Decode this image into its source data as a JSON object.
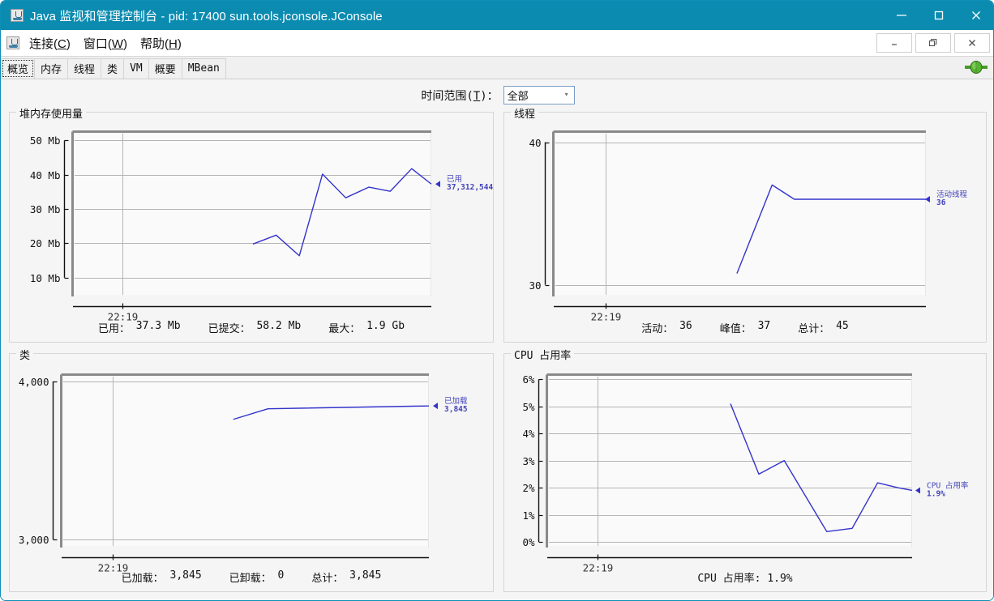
{
  "window": {
    "title": "Java 监视和管理控制台 - pid: 17400 sun.tools.jconsole.JConsole",
    "app_icon": "java-coffee-cup-icon",
    "minimize": "—",
    "maximize": "☐",
    "close": "✕"
  },
  "menubar": {
    "items": [
      {
        "label": "连接(C)",
        "text": "连接(",
        "mnemonic": "C",
        "tail": ")"
      },
      {
        "label": "窗口(W)",
        "text": "窗口(",
        "mnemonic": "W",
        "tail": ")"
      },
      {
        "label": "帮助(H)",
        "text": "帮助(",
        "mnemonic": "H",
        "tail": ")"
      }
    ],
    "inner_minimize": "_",
    "inner_restore": "❐",
    "inner_close": "×"
  },
  "tabs": [
    {
      "label": "概览",
      "selected": true
    },
    {
      "label": "内存",
      "selected": false
    },
    {
      "label": "线程",
      "selected": false
    },
    {
      "label": "类",
      "selected": false
    },
    {
      "label": "VM",
      "selected": false
    },
    {
      "label": "概要",
      "selected": false
    },
    {
      "label": "MBean",
      "selected": false
    }
  ],
  "connection_indicator": "green-plug-connected-icon",
  "timerange": {
    "label_text": "时间范围(",
    "label_mnemonic": "T",
    "label_tail": ")：",
    "value": "全部",
    "chevron": "∨"
  },
  "colors": {
    "titlebar": "#0b8bb0",
    "line": "#3333cc",
    "legend_text": "#4444bb",
    "grid": "#b4b4b4",
    "plot_bg": "#fafafa",
    "panel_border": "#d6d6d6",
    "connected_green": "#4caf32"
  },
  "chart_data": [
    {
      "type": "line",
      "id": "heap-memory",
      "title": "堆内存使用量",
      "ylabel": "",
      "xlabel": "",
      "ylim": [
        5,
        52
      ],
      "yticks": [
        10,
        20,
        30,
        40,
        50
      ],
      "ytick_labels": [
        "10 Mb",
        "20 Mb",
        "30 Mb",
        "40 Mb",
        "50 Mb"
      ],
      "xticks": [
        "22:19"
      ],
      "grid": true,
      "legend": {
        "name": "已用",
        "value": "37,312,544",
        "position": "right"
      },
      "series": [
        {
          "name": "已用",
          "x": [
            0.5,
            0.565,
            0.63,
            0.695,
            0.76,
            0.825,
            0.885,
            0.945,
            1.0
          ],
          "values": [
            19.8,
            22.4,
            16.4,
            40.2,
            33.3,
            36.4,
            35.2,
            41.8,
            37.3
          ]
        }
      ],
      "footer": [
        {
          "label": "已用：",
          "value": "37.3  Mb"
        },
        {
          "label": "已提交：",
          "value": "58.2  Mb"
        },
        {
          "label": "最大：",
          "value": "1.9  Gb"
        }
      ]
    },
    {
      "type": "line",
      "id": "threads",
      "title": "线程",
      "ylim": [
        29.3,
        40.6
      ],
      "yticks": [
        30,
        40
      ],
      "ytick_labels": [
        "30",
        "40"
      ],
      "xticks": [
        "22:19"
      ],
      "grid": true,
      "legend": {
        "name": "活动线程",
        "value": "36",
        "position": "right"
      },
      "series": [
        {
          "name": "活动线程",
          "x": [
            0.49,
            0.585,
            0.645,
            1.0
          ],
          "values": [
            30.8,
            37.0,
            36.0,
            36.0
          ]
        }
      ],
      "footer": [
        {
          "label": "活动：",
          "value": "36"
        },
        {
          "label": "峰值：",
          "value": "37"
        },
        {
          "label": "总计：",
          "value": "45"
        }
      ]
    },
    {
      "type": "line",
      "id": "classes",
      "title": "类",
      "ylim": [
        2960,
        4030
      ],
      "yticks": [
        3000,
        4000
      ],
      "ytick_labels": [
        "3,000",
        "4,000"
      ],
      "xticks": [
        "22:19"
      ],
      "grid": true,
      "legend": {
        "name": "已加载",
        "value": "3,845",
        "position": "right"
      },
      "series": [
        {
          "name": "已加载",
          "x": [
            0.465,
            0.56,
            1.0
          ],
          "values": [
            3760,
            3827,
            3845
          ]
        }
      ],
      "footer": [
        {
          "label": "已加载：",
          "value": "3,845"
        },
        {
          "label": "已卸载：",
          "value": "0"
        },
        {
          "label": "总计：",
          "value": "3,845"
        }
      ]
    },
    {
      "type": "line",
      "id": "cpu-usage",
      "title": "CPU 占用率",
      "ylim": [
        -0.15,
        6.1
      ],
      "yticks": [
        0,
        1,
        2,
        3,
        4,
        5,
        6
      ],
      "ytick_labels": [
        "0%",
        "1%",
        "2%",
        "3%",
        "4%",
        "5%",
        "6%"
      ],
      "xticks": [
        "22:19"
      ],
      "grid": true,
      "legend": {
        "name": "CPU 占用率",
        "value": "1.9%",
        "position": "right"
      },
      "series": [
        {
          "name": "CPU 占用率",
          "x": [
            0.5,
            0.578,
            0.648,
            0.765,
            0.835,
            0.905,
            0.96,
            1.0
          ],
          "values": [
            5.1,
            2.5,
            3.0,
            0.38,
            0.5,
            2.18,
            2.0,
            1.9
          ]
        }
      ],
      "footer": [
        {
          "label": "CPU 占用率: 1.9%",
          "value": ""
        }
      ]
    }
  ]
}
